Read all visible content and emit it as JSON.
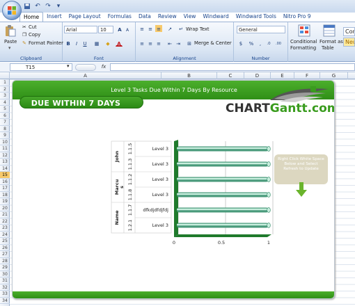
{
  "qat": {
    "undo": "↶",
    "redo": "↷",
    "more": "▾"
  },
  "tabs": [
    "Home",
    "Insert",
    "Page Layout",
    "Formulas",
    "Data",
    "Review",
    "View",
    "Windward",
    "Windward Tools",
    "Nitro Pro 9"
  ],
  "ribbon": {
    "clipboard": {
      "paste": "Paste",
      "cut": "Cut",
      "copy": "Copy",
      "format_painter": "Format Painter",
      "label": "Clipboard"
    },
    "font": {
      "name": "Arial",
      "size": "10",
      "bold": "B",
      "italic": "I",
      "underline": "U",
      "grow": "A",
      "shrink": "A",
      "font_color": "A",
      "label": "Font"
    },
    "alignment": {
      "wrap": "Wrap Text",
      "merge": "Merge & Center",
      "label": "Alignment"
    },
    "number": {
      "format": "General",
      "currency": "$",
      "percent": "%",
      "comma": ",",
      "inc_decimal": ".0",
      "dec_decimal": ".00",
      "label": "Number"
    },
    "styles": {
      "conditional": "Conditional",
      "conditional2": "Formatting",
      "format_as": "Format as",
      "format_as2": "Table",
      "cell_style_1": "Con",
      "cell_style_2": "Neu"
    }
  },
  "formula_bar": {
    "cell_ref": "T15",
    "fx": "fx"
  },
  "columns": [
    "A",
    "B",
    "C",
    "D",
    "E",
    "F",
    "G"
  ],
  "rows": [
    "1",
    "2",
    "3",
    "4",
    "5",
    "6",
    "7",
    "8",
    "9",
    "10",
    "11",
    "12",
    "13",
    "14",
    "15",
    "16",
    "17",
    "18",
    "19",
    "20",
    "21",
    "22",
    "23",
    "24",
    "25",
    "26",
    "27",
    "28",
    "29",
    "30",
    "31",
    "32",
    "33",
    "34"
  ],
  "selected_row": "15",
  "dashboard": {
    "banner_title": "Level 3 Tasks Due Within 7 Days By Resource",
    "due_label": "DUE  WITHIN 7 DAYS",
    "logo_part1": "CHART",
    "logo_part2": "Gantt.com",
    "note": "Right Click White Space Below and Select Refresh to Update"
  },
  "chart_data": {
    "type": "bar",
    "orientation": "horizontal",
    "categories": [
      "Level 3",
      "Level 3",
      "Level 3",
      "Level 3",
      "dfkdjdfdjfdj",
      "Level 3"
    ],
    "task_ids": [
      "1.1.5",
      "1.1.3",
      "1.1.2",
      "1.1.8",
      "1.1.7",
      "1.2.1"
    ],
    "groups": [
      {
        "name": "John",
        "rows": [
          0,
          1
        ]
      },
      {
        "name": "Marcu s",
        "rows": [
          2,
          3
        ]
      },
      {
        "name": "Name",
        "rows": [
          4,
          5
        ]
      }
    ],
    "values": [
      1,
      1,
      1,
      1,
      1,
      1
    ],
    "x_ticks": [
      "0",
      "0.5",
      "1"
    ],
    "xlim": [
      0,
      1
    ],
    "grid": true,
    "colors": {
      "bar_main": "#4a9a7b",
      "bar_light": "#c8eede",
      "floor": "#1f7a2c"
    }
  }
}
